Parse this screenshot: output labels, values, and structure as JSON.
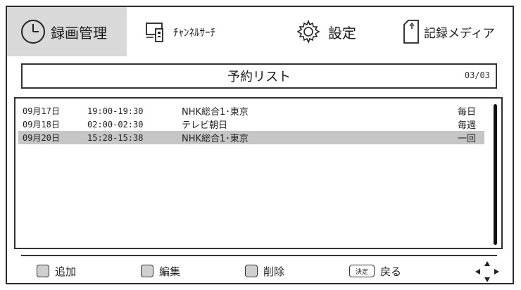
{
  "tabs": [
    {
      "label": "録画管理",
      "icon": "clock-icon",
      "active": true
    },
    {
      "label": "ﾁｬﾝﾈﾙｻｰﾁ",
      "icon": "antenna-remote-icon",
      "active": false
    },
    {
      "label": "設定",
      "icon": "gear-icon",
      "active": false
    },
    {
      "label": "記録メディア",
      "icon": "sd-card-icon",
      "active": false
    }
  ],
  "list": {
    "title": "予約リスト",
    "page": "03/03",
    "rows": [
      {
        "date": "09月17日",
        "time": "19:00-19:30",
        "channel": "NHK総合1･東京",
        "repeat": "毎日",
        "selected": false
      },
      {
        "date": "09月18日",
        "time": "02:00-02:30",
        "channel": "テレビ朝日",
        "repeat": "毎週",
        "selected": false
      },
      {
        "date": "09月20日",
        "time": "15:28-15:38",
        "channel": "NHK総合1･東京",
        "repeat": "一回",
        "selected": true
      }
    ]
  },
  "footer": {
    "add": {
      "label": "追加",
      "key": "赤"
    },
    "edit": {
      "label": "編集",
      "key": "緑"
    },
    "delete": {
      "label": "削除",
      "key": "青"
    },
    "back": {
      "label": "戻る",
      "key": "決定"
    }
  },
  "colors": {
    "active_tab": "#d9d9d9",
    "selected_row": "#c6c6c6",
    "border": "#333333"
  }
}
